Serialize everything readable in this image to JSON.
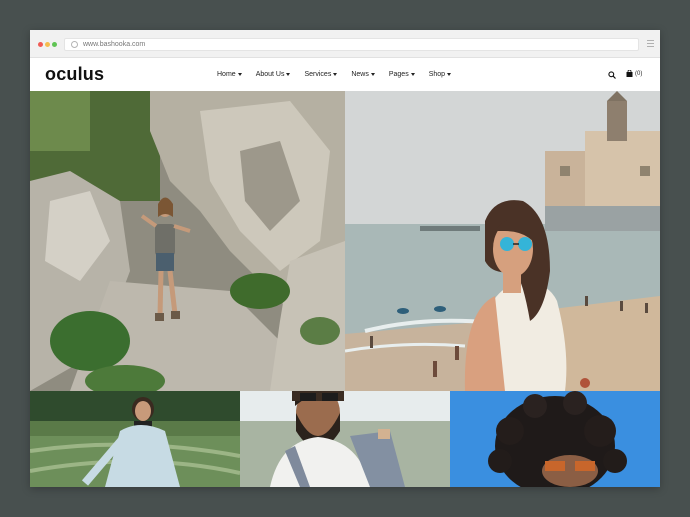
{
  "browser": {
    "url": "www.bashooka.com",
    "dot_colors": [
      "#f05b55",
      "#f5bd4f",
      "#5fc454"
    ]
  },
  "site": {
    "logo": "oculus",
    "nav": [
      {
        "label": "Home"
      },
      {
        "label": "About Us"
      },
      {
        "label": "Services"
      },
      {
        "label": "News"
      },
      {
        "label": "Pages"
      },
      {
        "label": "Shop"
      }
    ],
    "search_icon": "search-icon",
    "cart_icon": "shopping-bag-icon",
    "cart_count": "(0)"
  },
  "gallery": {
    "photos": [
      {
        "subject": "hiker-on-rocky-trail"
      },
      {
        "subject": "woman-with-blue-sunglasses-at-beach"
      },
      {
        "subject": "woman-in-field"
      },
      {
        "subject": "bearded-man-with-sunglasses"
      },
      {
        "subject": "curly-hair-portrait"
      }
    ]
  },
  "colors": {
    "background": "#48504f",
    "sky_blue": "#3a8fe0",
    "sea": "#a8b7b6"
  }
}
